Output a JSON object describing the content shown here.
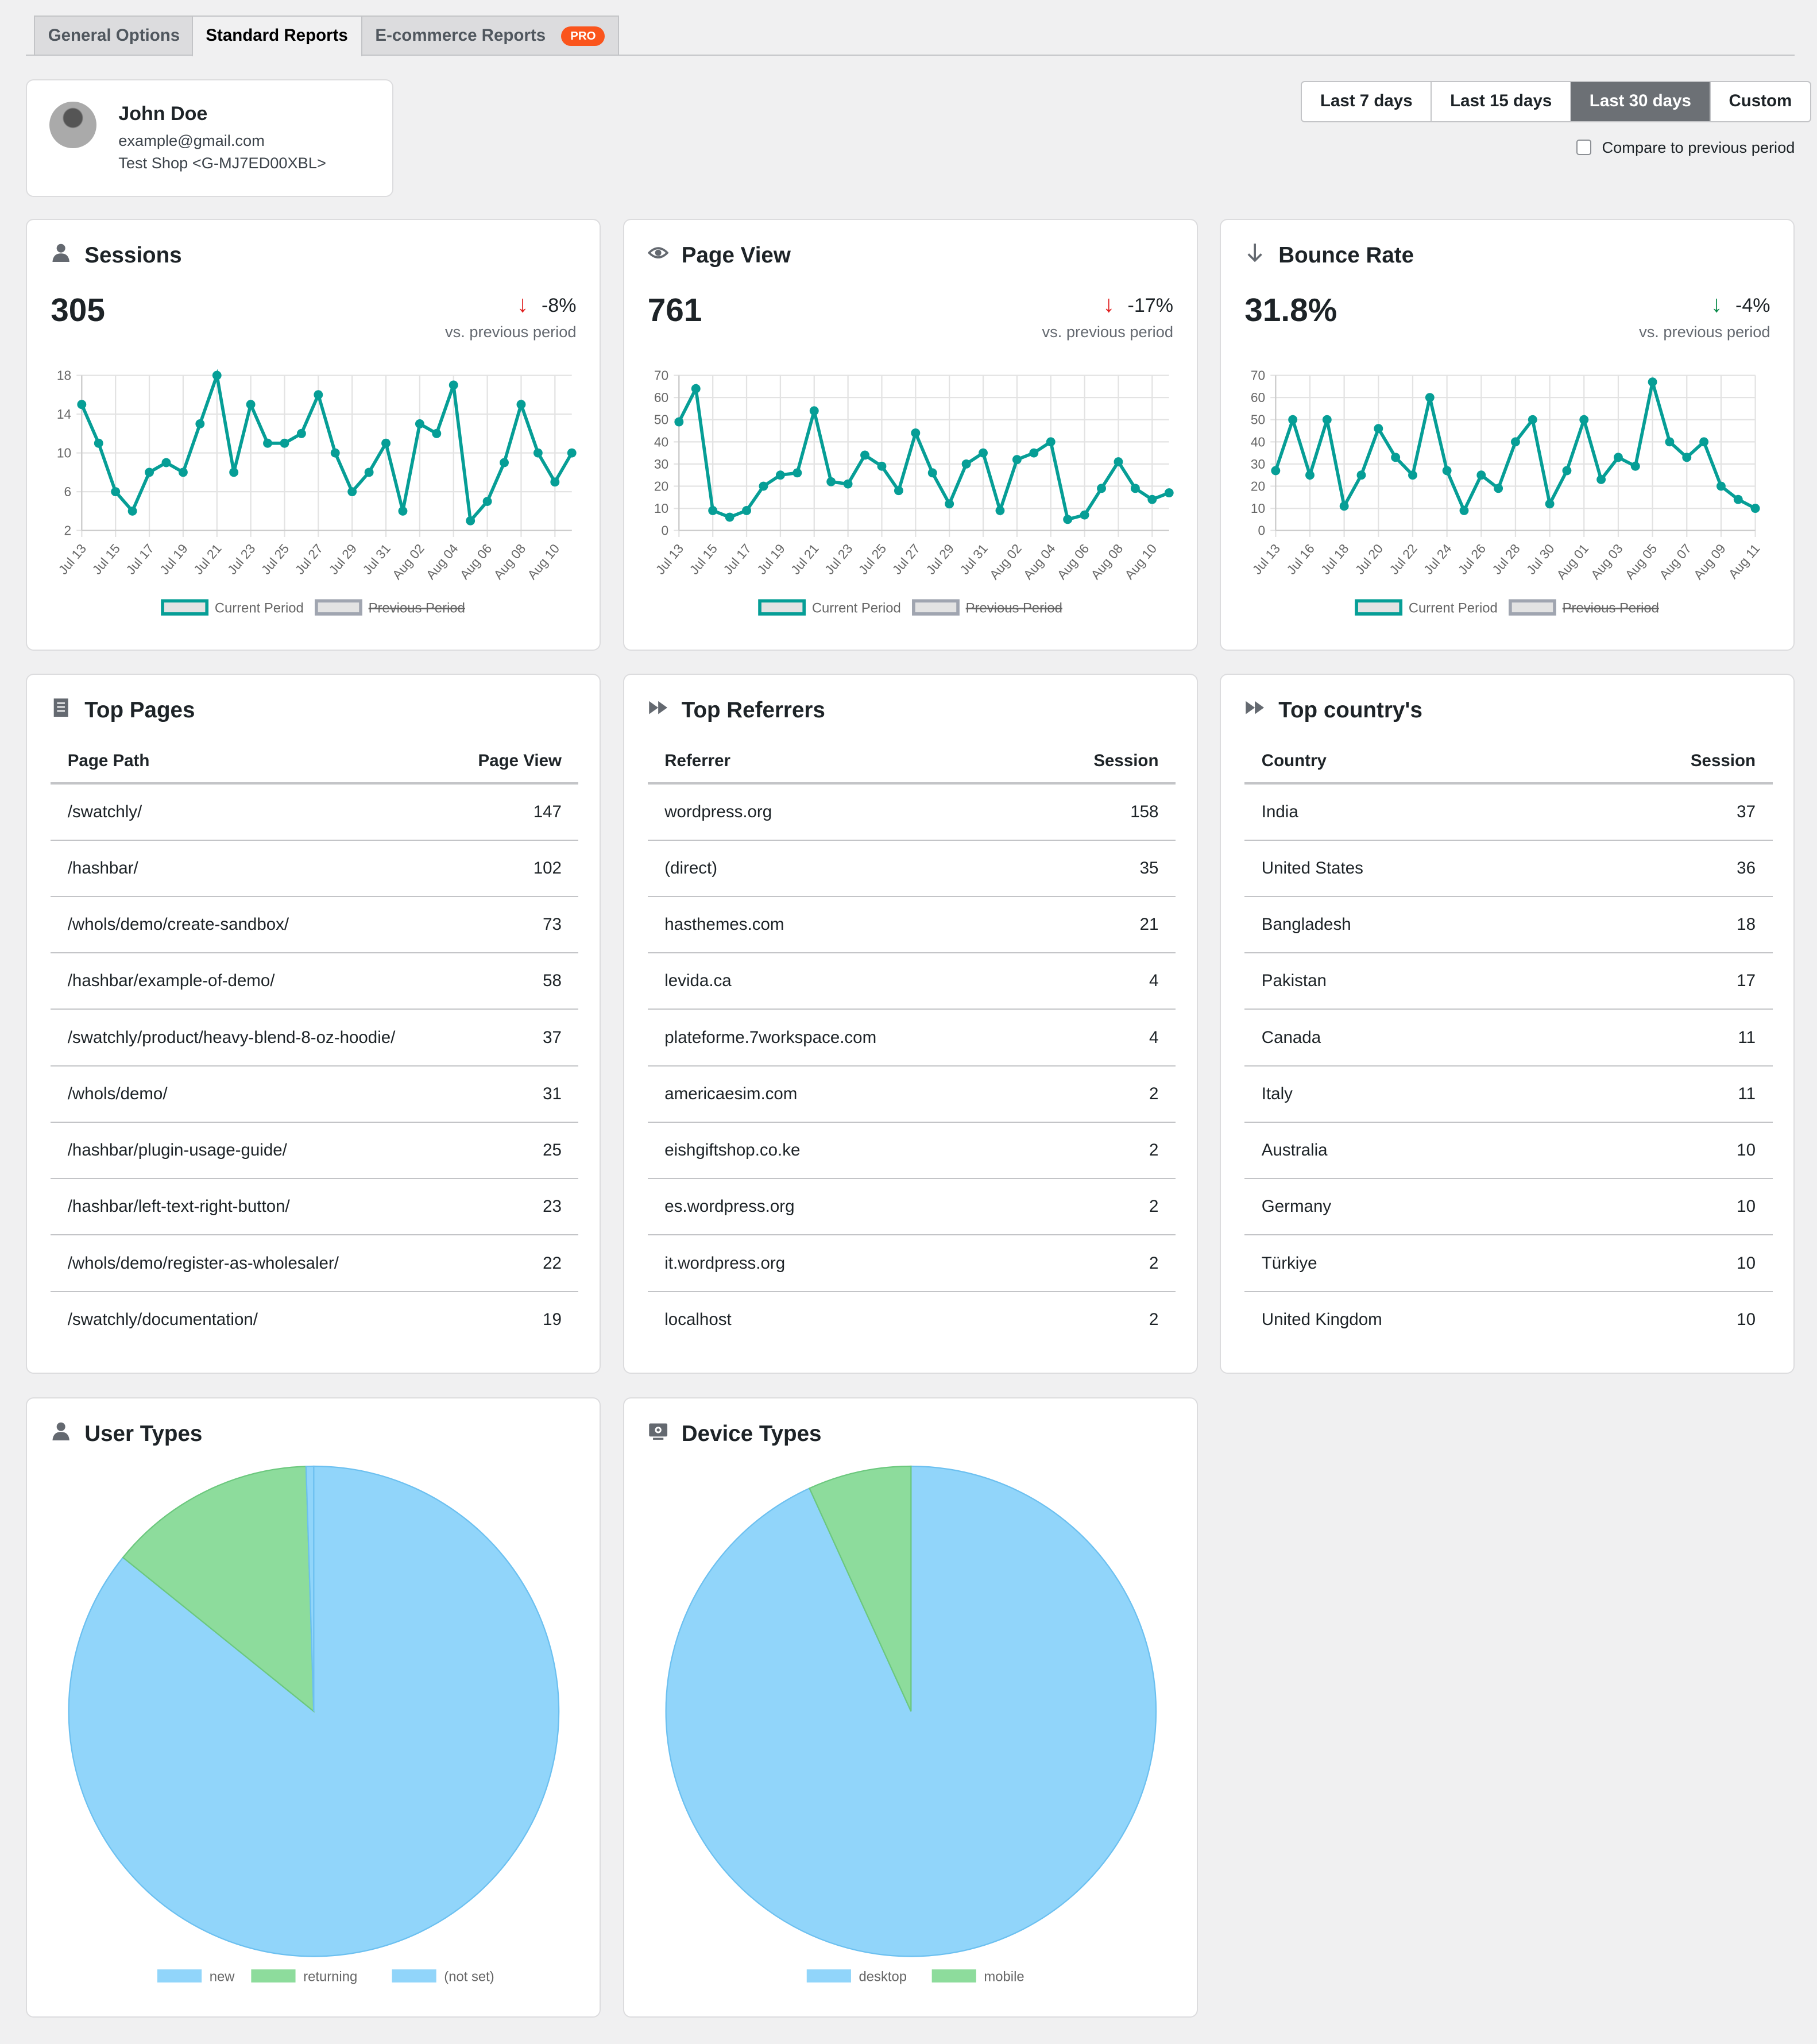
{
  "tabs": [
    {
      "label": "General Options"
    },
    {
      "label": "Standard Reports",
      "active": true
    },
    {
      "label": "E-commerce Reports",
      "badge": "PRO"
    }
  ],
  "profile": {
    "name": "John Doe",
    "email": "example@gmail.com",
    "property": "Test Shop <G-MJ7ED00XBL>"
  },
  "ranges": [
    {
      "label": "Last 7 days"
    },
    {
      "label": "Last 15 days"
    },
    {
      "label": "Last 30 days",
      "active": true
    },
    {
      "label": "Custom"
    }
  ],
  "compare": {
    "label": "Compare to previous period",
    "checked": false
  },
  "colors": {
    "line": "#069e96",
    "down_bad": "#e02020",
    "down_good": "#0a8a4a",
    "pie_blue": "#91d5fa",
    "pie_green": "#8ddc9c"
  },
  "metrics": [
    {
      "title": "Sessions",
      "icon": "user-icon",
      "value": "305",
      "change": "-8%",
      "arrow_color": "#e02020",
      "vs": "vs. previous period"
    },
    {
      "title": "Page View",
      "icon": "eye-icon",
      "value": "761",
      "change": "-17%",
      "arrow_color": "#e02020",
      "vs": "vs. previous period"
    },
    {
      "title": "Bounce Rate",
      "icon": "arrow-down-icon",
      "value": "31.8%",
      "change": "-4%",
      "arrow_color": "#0a8a4a",
      "vs": "vs. previous period"
    }
  ],
  "legend": {
    "current": "Current Period",
    "previous": "Previous Period"
  },
  "chart_data": [
    {
      "type": "line",
      "series": [
        {
          "name": "Current Period",
          "values": [
            15,
            11,
            6,
            4,
            8,
            9,
            8,
            13,
            18,
            8,
            15,
            11,
            11,
            12,
            16,
            10,
            6,
            8,
            11,
            4,
            13,
            12,
            17,
            3,
            5,
            9,
            15,
            10,
            7,
            10
          ]
        }
      ],
      "x_tick_labels": [
        "Jul 13",
        "Jul 15",
        "Jul 17",
        "Jul 19",
        "Jul 21",
        "Jul 23",
        "Jul 25",
        "Jul 27",
        "Jul 29",
        "Jul 31",
        "Aug 02",
        "Aug 04",
        "Aug 06",
        "Aug 08",
        "Aug 10"
      ],
      "ylim": [
        2,
        18
      ],
      "yticks": [
        2,
        6,
        10,
        14,
        18
      ],
      "grid": true,
      "legend": "bottom"
    },
    {
      "type": "line",
      "series": [
        {
          "name": "Current Period",
          "values": [
            49,
            64,
            9,
            6,
            9,
            20,
            25,
            26,
            54,
            22,
            21,
            34,
            29,
            18,
            44,
            26,
            12,
            30,
            35,
            9,
            32,
            35,
            40,
            5,
            7,
            19,
            31,
            19,
            14,
            17
          ]
        }
      ],
      "x_tick_labels": [
        "Jul 13",
        "Jul 15",
        "Jul 17",
        "Jul 19",
        "Jul 21",
        "Jul 23",
        "Jul 25",
        "Jul 27",
        "Jul 29",
        "Jul 31",
        "Aug 02",
        "Aug 04",
        "Aug 06",
        "Aug 08",
        "Aug 10"
      ],
      "ylim": [
        0,
        70
      ],
      "yticks": [
        0,
        10,
        20,
        30,
        40,
        50,
        60,
        70
      ],
      "grid": true,
      "legend": "bottom"
    },
    {
      "type": "line",
      "series": [
        {
          "name": "Current Period",
          "values": [
            27,
            50,
            25,
            50,
            11,
            25,
            46,
            33,
            25,
            60,
            27,
            9,
            25,
            19,
            40,
            50,
            12,
            27,
            50,
            23,
            33,
            29,
            67,
            40,
            33,
            40,
            20,
            14,
            10
          ]
        }
      ],
      "x_tick_labels": [
        "Jul 13",
        "Jul 16",
        "Jul 18",
        "Jul 20",
        "Jul 22",
        "Jul 24",
        "Jul 26",
        "Jul 28",
        "Jul 30",
        "Aug 01",
        "Aug 03",
        "Aug 05",
        "Aug 07",
        "Aug 09",
        "Aug 11"
      ],
      "ylim": [
        0,
        70
      ],
      "yticks": [
        0,
        10,
        20,
        30,
        40,
        50,
        60,
        70
      ],
      "grid": true,
      "legend": "bottom"
    },
    {
      "type": "pie",
      "title": "User Types",
      "labels": [
        "new",
        "returning",
        "(not set)"
      ],
      "values": [
        85.8,
        13.7,
        0.5
      ],
      "colors": [
        "#91d5fa",
        "#8ddc9c",
        "#91d5fa"
      ]
    },
    {
      "type": "pie",
      "title": "Device Types",
      "labels": [
        "desktop",
        "mobile"
      ],
      "values": [
        93.2,
        6.8
      ],
      "colors": [
        "#91d5fa",
        "#8ddc9c"
      ]
    }
  ],
  "tables": [
    {
      "title": "Top Pages",
      "icon": "document-icon",
      "headers": [
        "Page Path",
        "Page View"
      ],
      "rows": [
        [
          "/swatchly/",
          "147"
        ],
        [
          "/hashbar/",
          "102"
        ],
        [
          "/whols/demo/create-sandbox/",
          "73"
        ],
        [
          "/hashbar/example-of-demo/",
          "58"
        ],
        [
          "/swatchly/product/heavy-blend-8-oz-hoodie/",
          "37"
        ],
        [
          "/whols/demo/",
          "31"
        ],
        [
          "/hashbar/plugin-usage-guide/",
          "25"
        ],
        [
          "/hashbar/left-text-right-button/",
          "23"
        ],
        [
          "/whols/demo/register-as-wholesaler/",
          "22"
        ],
        [
          "/swatchly/documentation/",
          "19"
        ]
      ]
    },
    {
      "title": "Top Referrers",
      "icon": "fast-forward-icon",
      "headers": [
        "Referrer",
        "Session"
      ],
      "rows": [
        [
          "wordpress.org",
          "158"
        ],
        [
          "(direct)",
          "35"
        ],
        [
          "hasthemes.com",
          "21"
        ],
        [
          "levida.ca",
          "4"
        ],
        [
          "plateforme.7workspace.com",
          "4"
        ],
        [
          "americaesim.com",
          "2"
        ],
        [
          "eishgiftshop.co.ke",
          "2"
        ],
        [
          "es.wordpress.org",
          "2"
        ],
        [
          "it.wordpress.org",
          "2"
        ],
        [
          "localhost",
          "2"
        ]
      ]
    },
    {
      "title": "Top country's",
      "icon": "fast-forward-icon",
      "headers": [
        "Country",
        "Session"
      ],
      "rows": [
        [
          "India",
          "37"
        ],
        [
          "United States",
          "36"
        ],
        [
          "Bangladesh",
          "18"
        ],
        [
          "Pakistan",
          "17"
        ],
        [
          "Canada",
          "11"
        ],
        [
          "Italy",
          "11"
        ],
        [
          "Australia",
          "10"
        ],
        [
          "Germany",
          "10"
        ],
        [
          "Türkiye",
          "10"
        ],
        [
          "United Kingdom",
          "10"
        ]
      ]
    }
  ],
  "pies": [
    {
      "title": "User Types",
      "icon": "user-icon"
    },
    {
      "title": "Device Types",
      "icon": "monitor-icon"
    }
  ]
}
